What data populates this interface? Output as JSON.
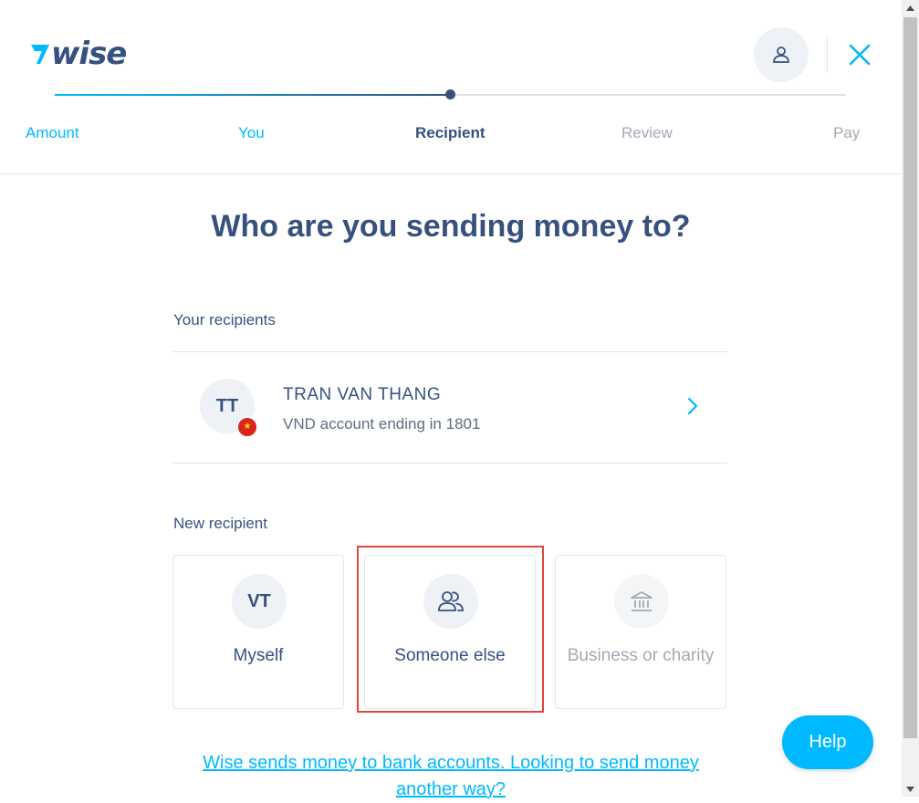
{
  "brand": {
    "logo_text": "wise"
  },
  "colors": {
    "primary": "#37517e",
    "accent": "#00b9ff",
    "muted": "#a3a9b3",
    "highlight": "#e0463f"
  },
  "header": {
    "profile_icon": "user-icon",
    "close_icon": "close-icon"
  },
  "stepper": {
    "progress_fraction": 0.5,
    "steps": [
      {
        "label": "Amount",
        "state": "done"
      },
      {
        "label": "You",
        "state": "done"
      },
      {
        "label": "Recipient",
        "state": "current"
      },
      {
        "label": "Review",
        "state": "todo"
      },
      {
        "label": "Pay",
        "state": "todo"
      }
    ]
  },
  "main": {
    "title": "Who are you sending money to?",
    "your_recipients": {
      "heading": "Your recipients",
      "items": [
        {
          "initials": "TT",
          "name": "TRAN VAN THANG",
          "subtitle": "VND account ending in 1801",
          "flag": "★"
        }
      ]
    },
    "new_recipient": {
      "heading": "New recipient",
      "options": [
        {
          "initials": "VT",
          "label": "Myself"
        },
        {
          "icon": "people-icon",
          "label": "Someone else"
        },
        {
          "icon": "bank-icon",
          "label": "Business or charity"
        }
      ]
    },
    "footer_link": "Wise sends money to bank accounts. Looking to send money another way?"
  },
  "help": {
    "label": "Help"
  }
}
